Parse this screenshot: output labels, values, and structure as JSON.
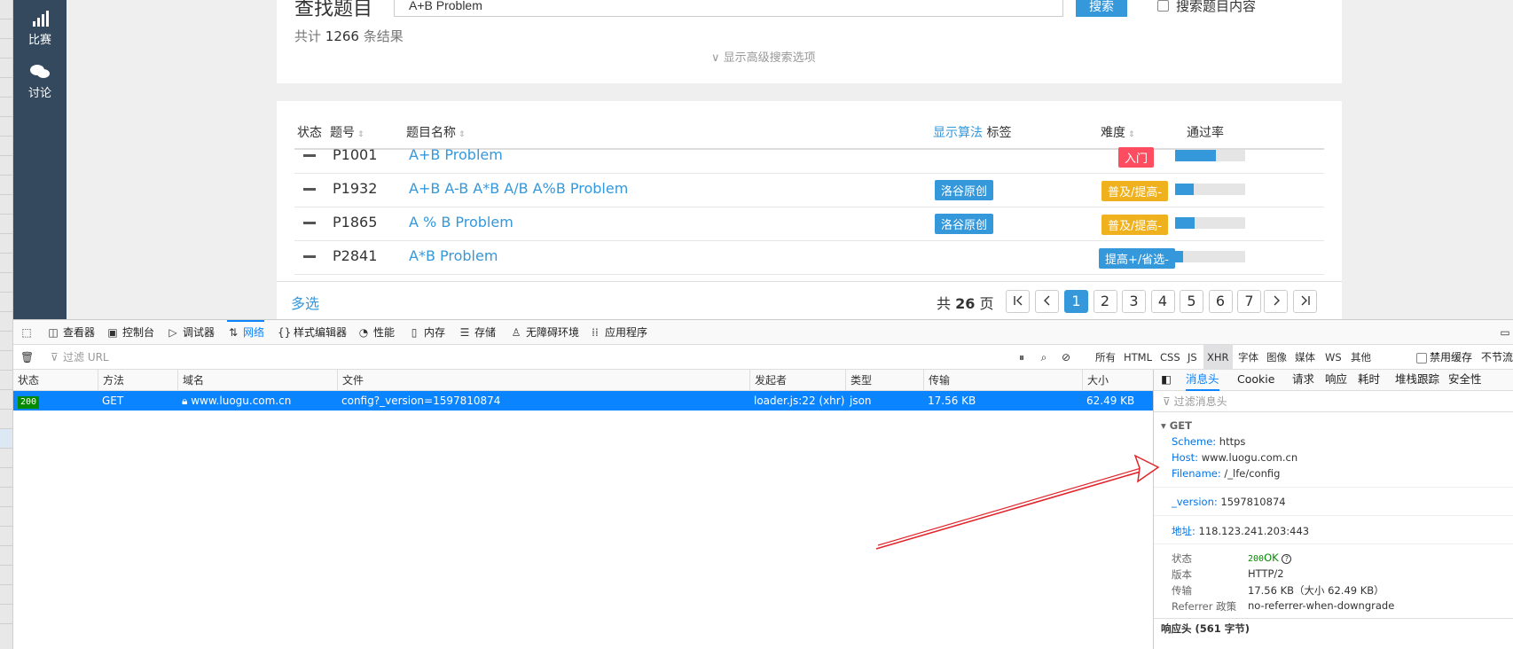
{
  "left_strip": [
    "",
    "",
    "",
    "",
    "",
    "",
    "",
    "",
    "",
    "",
    "",
    "",
    "",
    "",
    "",
    "",
    "",
    "",
    "",
    "",
    "",
    "",
    "",
    "",
    "",
    "",
    "",
    "",
    "",
    "",
    "",
    ""
  ],
  "sidebar": {
    "items": [
      {
        "icon": "signal-bars-icon",
        "glyph": "▮",
        "label": "比赛"
      },
      {
        "icon": "chat-bubbles-icon",
        "glyph": "●",
        "label": "讨论"
      }
    ]
  },
  "search": {
    "title": "查找题目",
    "input_value": "A+B Problem",
    "button": "搜索",
    "content_option": "搜索题目内容",
    "result_prefix": "共计",
    "result_count": "1266",
    "result_suffix": "条结果",
    "advanced": "∨ 显示高级搜索选项"
  },
  "table": {
    "headers": {
      "status": "状态",
      "id": "题号",
      "name": "题目名称",
      "show_algo": "显示算法",
      "tags": "标签",
      "difficulty": "难度",
      "pass_rate": "通过率"
    },
    "rows": [
      {
        "id": "P1001",
        "name": "A+B Problem",
        "tag": "",
        "difficulty": "入门",
        "diff_color": "#fe4c61",
        "pass": 0.58
      },
      {
        "id": "P1932",
        "name": "A+B A-B A*B A/B A%B Problem",
        "tag": "洛谷原创",
        "difficulty": "普及/提高-",
        "diff_color": "#f0b11e",
        "pass": 0.26
      },
      {
        "id": "P1865",
        "name": "A % B Problem",
        "tag": "洛谷原创",
        "difficulty": "普及/提高-",
        "diff_color": "#f0b11e",
        "pass": 0.28
      },
      {
        "id": "P2841",
        "name": "A*B Problem",
        "tag": "",
        "difficulty": "提高+/省选-",
        "diff_color": "#3498db",
        "pass": 0.12
      }
    ]
  },
  "pagination": {
    "multi_select": "多选",
    "total_prefix": "共",
    "total_pages": "26",
    "total_suffix": "页",
    "first": "|<",
    "prev": "<",
    "pages": [
      "1",
      "2",
      "3",
      "4",
      "5",
      "6",
      "7"
    ],
    "next": ">",
    "last": ">|",
    "active_page": "1"
  },
  "devtools": {
    "tabs": [
      {
        "icon": "inspector-icon",
        "glyph": "◫",
        "label": "查看器"
      },
      {
        "icon": "console-icon",
        "glyph": "▣",
        "label": "控制台"
      },
      {
        "icon": "debugger-icon",
        "glyph": "▷",
        "label": "调试器"
      },
      {
        "icon": "network-icon",
        "glyph": "⇅",
        "label": "网络"
      },
      {
        "icon": "style-editor-icon",
        "glyph": "{}",
        "label": "样式编辑器"
      },
      {
        "icon": "performance-icon",
        "glyph": "◔",
        "label": "性能"
      },
      {
        "icon": "memory-icon",
        "glyph": "▯",
        "label": "内存"
      },
      {
        "icon": "storage-icon",
        "glyph": "☰",
        "label": "存储"
      },
      {
        "icon": "accessibility-icon",
        "glyph": "♙",
        "label": "无障碍环境"
      },
      {
        "icon": "application-icon",
        "glyph": "⁞⁞",
        "label": "应用程序"
      }
    ],
    "active_tab": "网络",
    "filter_placeholder": "过滤 URL",
    "type_filters": [
      "所有",
      "HTML",
      "CSS",
      "JS",
      "XHR",
      "字体",
      "图像",
      "媒体",
      "WS",
      "其他"
    ],
    "active_filter": "XHR",
    "disable_cache": "禁用缓存",
    "throttle": "不节流",
    "columns": [
      "状态",
      "方法",
      "域名",
      "文件",
      "发起者",
      "类型",
      "传输",
      "大小"
    ],
    "request": {
      "status": "200",
      "method": "GET",
      "domain": "www.luogu.com.cn",
      "file": "config?_version=1597810874",
      "initiator": "loader.js:22 (xhr)",
      "type": "json",
      "transferred": "17.56 KB",
      "size": "62.49 KB"
    },
    "panel": {
      "tabs": [
        "消息头",
        "Cookie",
        "请求",
        "响应",
        "耗时",
        "堆栈跟踪",
        "安全性"
      ],
      "active_tab": "消息头",
      "filter_placeholder": "过滤消息头",
      "method_header": "GET",
      "scheme_label": "Scheme:",
      "scheme": "https",
      "host_label": "Host:",
      "host": "www.luogu.com.cn",
      "filename_label": "Filename:",
      "filename": "/_lfe/config",
      "version_label": "_version:",
      "version": "1597810874",
      "address_label": "地址:",
      "address": "118.123.241.203:443",
      "status_label": "状态",
      "status_code": "200",
      "status_text": "OK",
      "version_row_label": "版本",
      "http_version": "HTTP/2",
      "transfer_label": "传输",
      "transfer": "17.56 KB（大小 62.49 KB）",
      "referrer_label": "Referrer 政策",
      "referrer": "no-referrer-when-downgrade",
      "response_headers": "响应头 (561 字节)"
    }
  },
  "colors": {
    "accent": "#3498db",
    "sidebar": "#34495e",
    "devtools_blue": "#0a84ff",
    "arrow": "#e0262c"
  }
}
